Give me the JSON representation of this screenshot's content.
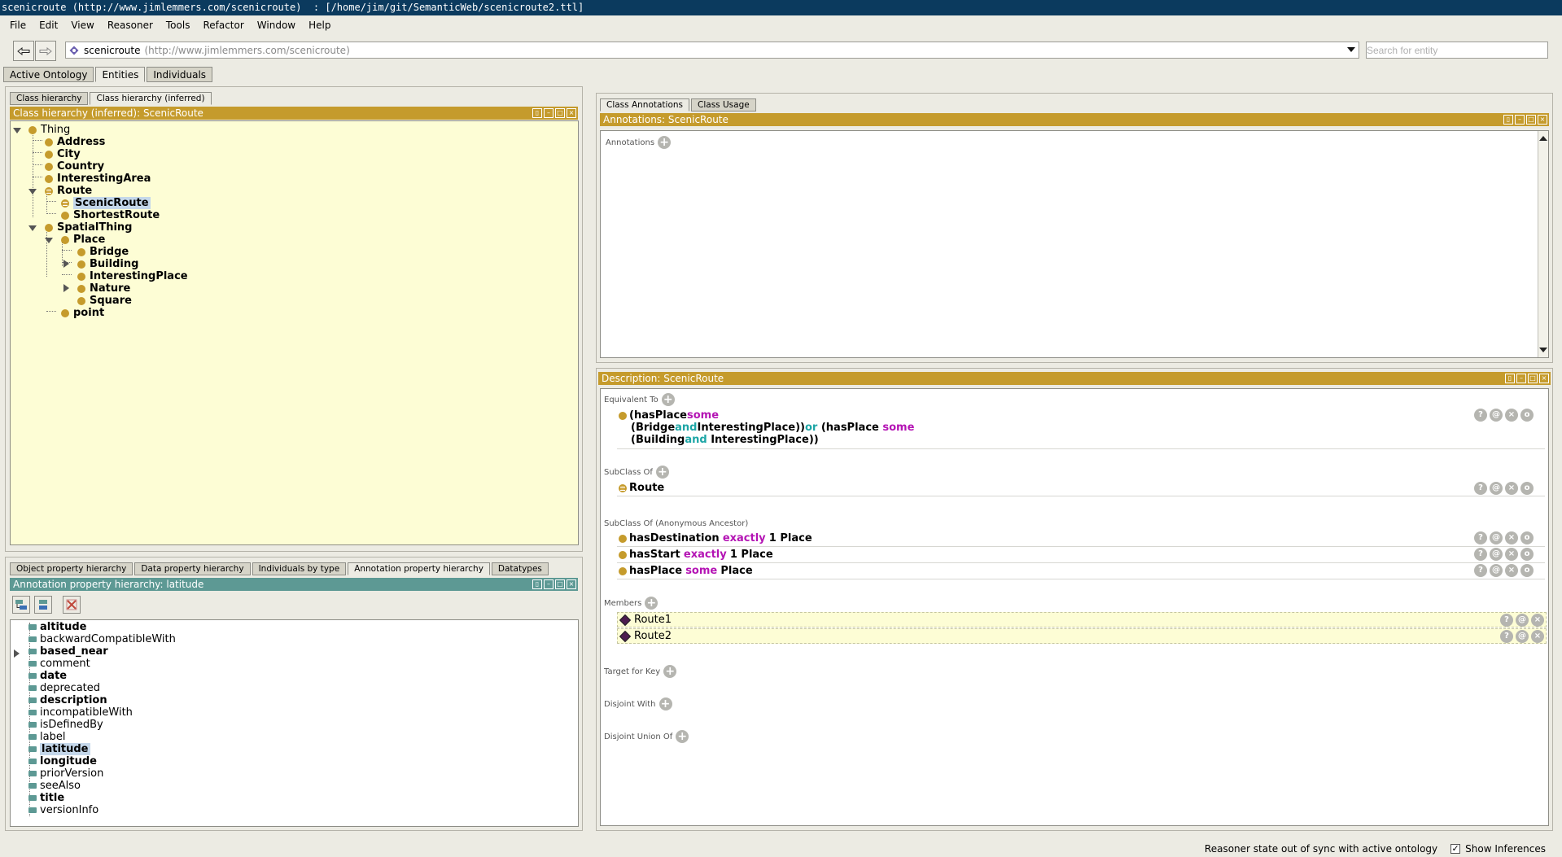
{
  "window": {
    "title": "scenicroute (http://www.jimlemmers.com/scenicroute)  : [/home/jim/git/SemanticWeb/scenicroute2.ttl]"
  },
  "menu": [
    "File",
    "Edit",
    "View",
    "Reasoner",
    "Tools",
    "Refactor",
    "Window",
    "Help"
  ],
  "toolbar": {
    "ontology_name": "scenicroute",
    "ontology_iri": "(http://www.jimlemmers.com/scenicroute)",
    "search_placeholder": "Search for entity"
  },
  "main_tabs": [
    "Active Ontology",
    "Entities",
    "Individuals"
  ],
  "class_panel": {
    "tabs": [
      "Class hierarchy",
      "Class hierarchy (inferred)"
    ],
    "header": "Class hierarchy (inferred): ScenicRoute",
    "nodes": [
      {
        "label": "Thing",
        "bold": false,
        "icon": "class-icon"
      },
      {
        "label": "Address",
        "bold": true,
        "icon": "class-icon"
      },
      {
        "label": "City",
        "bold": true,
        "icon": "class-icon"
      },
      {
        "label": "Country",
        "bold": true,
        "icon": "class-icon"
      },
      {
        "label": "InterestingArea",
        "bold": true,
        "icon": "class-icon"
      },
      {
        "label": "Route",
        "bold": true,
        "icon": "defined-class-icon"
      },
      {
        "label": "ScenicRoute",
        "bold": true,
        "icon": "defined-class-icon",
        "selected": true
      },
      {
        "label": "ShortestRoute",
        "bold": true,
        "icon": "class-icon"
      },
      {
        "label": "SpatialThing",
        "bold": true,
        "icon": "class-icon"
      },
      {
        "label": "Place",
        "bold": true,
        "icon": "class-icon"
      },
      {
        "label": "Bridge",
        "bold": true,
        "icon": "class-icon"
      },
      {
        "label": "Building",
        "bold": true,
        "icon": "class-icon"
      },
      {
        "label": "InterestingPlace",
        "bold": true,
        "icon": "class-icon"
      },
      {
        "label": "Nature",
        "bold": true,
        "icon": "class-icon"
      },
      {
        "label": "Square",
        "bold": true,
        "icon": "class-icon"
      },
      {
        "label": "point",
        "bold": true,
        "icon": "class-icon"
      }
    ]
  },
  "property_panel": {
    "tabs": [
      "Object property hierarchy",
      "Data property hierarchy",
      "Individuals by type",
      "Annotation property hierarchy",
      "Datatypes"
    ],
    "header": "Annotation property hierarchy: latitude",
    "items": [
      {
        "label": "altitude",
        "bold": true
      },
      {
        "label": "backwardCompatibleWith",
        "bold": false
      },
      {
        "label": "based_near",
        "bold": true
      },
      {
        "label": "comment",
        "bold": false
      },
      {
        "label": "date",
        "bold": true
      },
      {
        "label": "deprecated",
        "bold": false
      },
      {
        "label": "description",
        "bold": true
      },
      {
        "label": "incompatibleWith",
        "bold": false
      },
      {
        "label": "isDefinedBy",
        "bold": false
      },
      {
        "label": "label",
        "bold": false
      },
      {
        "label": "latitude",
        "bold": true,
        "selected": true
      },
      {
        "label": "longitude",
        "bold": true
      },
      {
        "label": "priorVersion",
        "bold": false
      },
      {
        "label": "seeAlso",
        "bold": false
      },
      {
        "label": "title",
        "bold": true
      },
      {
        "label": "versionInfo",
        "bold": false
      }
    ]
  },
  "annotations_panel": {
    "tabs": [
      "Class Annotations",
      "Class Usage"
    ],
    "header": "Annotations: ScenicRoute",
    "label": "Annotations"
  },
  "description_panel": {
    "header": "Description: ScenicRoute",
    "equivalent_label": "Equivalent To",
    "equivalent": {
      "line1": {
        "a": "(hasPlace ",
        "b": "some"
      },
      "line2": {
        "a": "(Bridge ",
        "b": "and",
        "c": " InterestingPlace)) ",
        "d": "or",
        "e": " (hasPlace ",
        "f": "some"
      },
      "line3": {
        "a": "(Building ",
        "b": "and",
        "c": " InterestingPlace))"
      }
    },
    "subclass_label": "SubClass Of",
    "subclass_of": "Route",
    "anon_label": "SubClass Of (Anonymous Ancestor)",
    "anon": [
      {
        "prop": "hasDestination",
        "kw": "exactly",
        "rest": "1 Place"
      },
      {
        "prop": "hasStart",
        "kw": "exactly",
        "rest": "1 Place"
      },
      {
        "prop": "hasPlace",
        "kw": "some",
        "rest": "Place"
      }
    ],
    "members_label": "Members",
    "members": [
      "Route1",
      "Route2"
    ],
    "target_label": "Target for Key",
    "disjoint_label": "Disjoint With",
    "disjoint_union_label": "Disjoint Union Of"
  },
  "status": {
    "message": "Reasoner state out of sync with active ontology",
    "show_inferences": "Show Inferences"
  },
  "colors": {
    "gold_header": "#c59b2c",
    "teal_header": "#5d9994",
    "class_dot": "#c59b2c",
    "title_bar": "#0b3a5e",
    "keyword_magenta": "#b414b4",
    "keyword_cyan": "#1da6a6"
  }
}
